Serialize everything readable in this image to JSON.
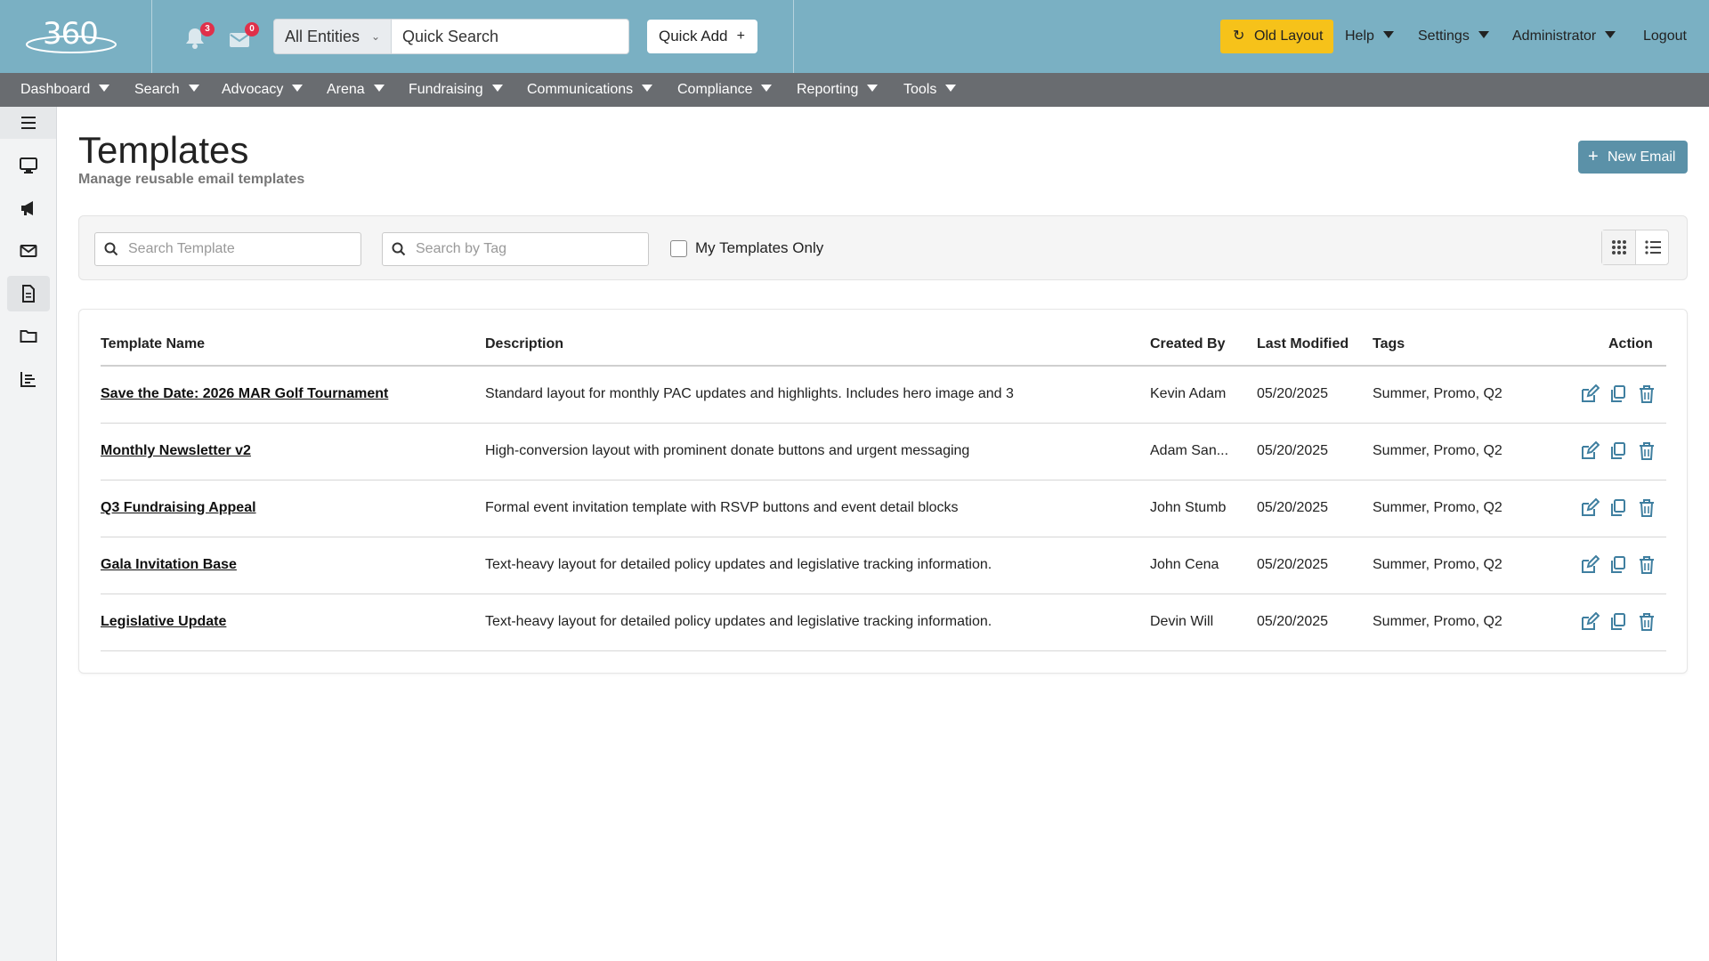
{
  "header": {
    "logo_text": "360",
    "notifications_count": "3",
    "messages_count": "0",
    "entity_select": "All Entities",
    "quick_search_placeholder": "Quick Search",
    "quick_add_label": "Quick Add",
    "old_layout_label": "Old Layout",
    "menus": [
      "Help",
      "Settings",
      "Administrator"
    ],
    "logout_label": "Logout"
  },
  "nav": {
    "items": [
      "Dashboard",
      "Search",
      "Advocacy",
      "Arena",
      "Fundraising",
      "Communications",
      "Compliance",
      "Reporting",
      "Tools"
    ]
  },
  "sidebar": {
    "items": [
      {
        "icon": "monitor-icon"
      },
      {
        "icon": "megaphone-icon"
      },
      {
        "icon": "envelope-icon"
      },
      {
        "icon": "document-icon",
        "active": true
      },
      {
        "icon": "folder-icon"
      },
      {
        "icon": "bar-chart-icon"
      }
    ]
  },
  "page": {
    "title": "Templates",
    "subtitle": "Manage reusable email templates",
    "new_email_label": "New Email"
  },
  "filters": {
    "search_template_placeholder": "Search Template",
    "search_tag_placeholder": "Search by Tag",
    "my_templates_label": "My Templates Only",
    "my_templates_checked": false
  },
  "table": {
    "headers": [
      "Template Name",
      "Description",
      "Created By",
      "Last Modified",
      "Tags",
      "Action"
    ],
    "rows": [
      {
        "name": "Save the Date: 2026 MAR Golf Tournament",
        "description": "Standard layout for monthly PAC updates and highlights. Includes hero image and 3",
        "created_by": "Kevin Adam",
        "modified": "05/20/2025",
        "tags": "Summer, Promo, Q2"
      },
      {
        "name": "Monthly Newsletter v2",
        "description": "High-conversion layout with prominent donate buttons and urgent messaging",
        "created_by": "Adam San...",
        "modified": "05/20/2025",
        "tags": "Summer, Promo, Q2"
      },
      {
        "name": "Q3 Fundraising Appeal",
        "description": "Formal event invitation template with RSVP buttons and event detail blocks",
        "created_by": "John Stumb",
        "modified": "05/20/2025",
        "tags": "Summer, Promo, Q2"
      },
      {
        "name": "Gala Invitation Base",
        "description": "Text-heavy layout for detailed policy updates and legislative tracking information.",
        "created_by": "John Cena",
        "modified": "05/20/2025",
        "tags": "Summer, Promo, Q2"
      },
      {
        "name": "Legislative Update",
        "description": "Text-heavy layout for detailed policy updates and legislative tracking information.",
        "created_by": "Devin Will",
        "modified": "05/20/2025",
        "tags": "Summer, Promo, Q2"
      }
    ]
  },
  "colors": {
    "header_bg": "#7ab0c3",
    "nav_bg": "#696c70",
    "accent": "#5b91a8",
    "old_layout_bg": "#f6c21a",
    "badge": "#e0304a"
  }
}
